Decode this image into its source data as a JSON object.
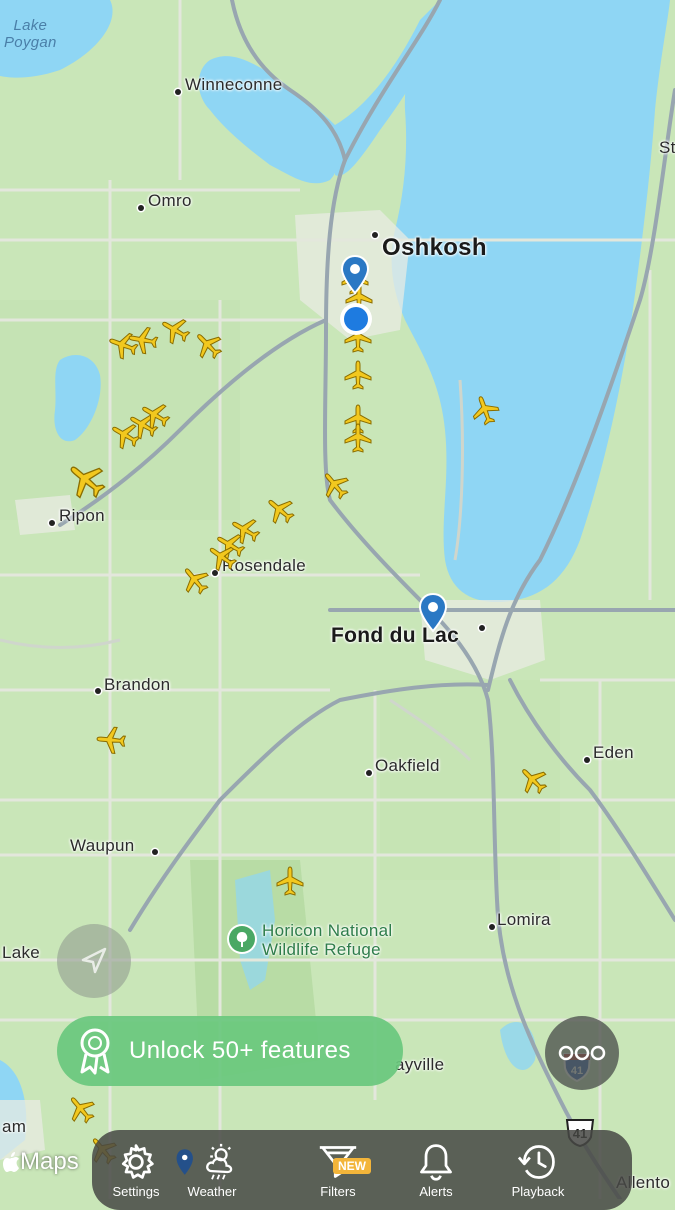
{
  "colors": {
    "land": "#c9e6b8",
    "water": "#8fd6f4",
    "road_major": "#8a9aa8",
    "road_minor": "#d9dfd3",
    "plane": "#f2c81e",
    "pin": "#2a78c4",
    "unlock_bg": "#69c87d"
  },
  "places": {
    "lake_poygan": "Lake\nPoygan",
    "winneconne": "Winneconne",
    "omro": "Omro",
    "oshkosh": "Oshkosh",
    "ripon": "Ripon",
    "rosendale": "Rosendale",
    "fond_du_lac": "Fond du Lac",
    "brandon": "Brandon",
    "oakfield": "Oakfield",
    "eden": "Eden",
    "waupun": "Waupun",
    "lomira": "Lomira",
    "lake": "Lake",
    "horicon": "Horicon National\nWildlife Refuge",
    "mayville": "ayville",
    "allenton": "Allento",
    "am": "am",
    "st": "St"
  },
  "highway_shield": "41",
  "unlock": {
    "label": "Unlock 50+ features",
    "icon": "ribbon-badge-icon"
  },
  "attribution": "Maps",
  "toolbar": {
    "items": [
      {
        "icon": "gear-icon",
        "label": "Settings"
      },
      {
        "icon": "weather-icon",
        "label": "Weather"
      },
      {
        "icon": "filter-icon",
        "label": "Filters"
      },
      {
        "icon": "bell-icon",
        "label": "Alerts"
      },
      {
        "icon": "history-icon",
        "label": "Playback"
      }
    ],
    "new_badge": "NEW"
  }
}
